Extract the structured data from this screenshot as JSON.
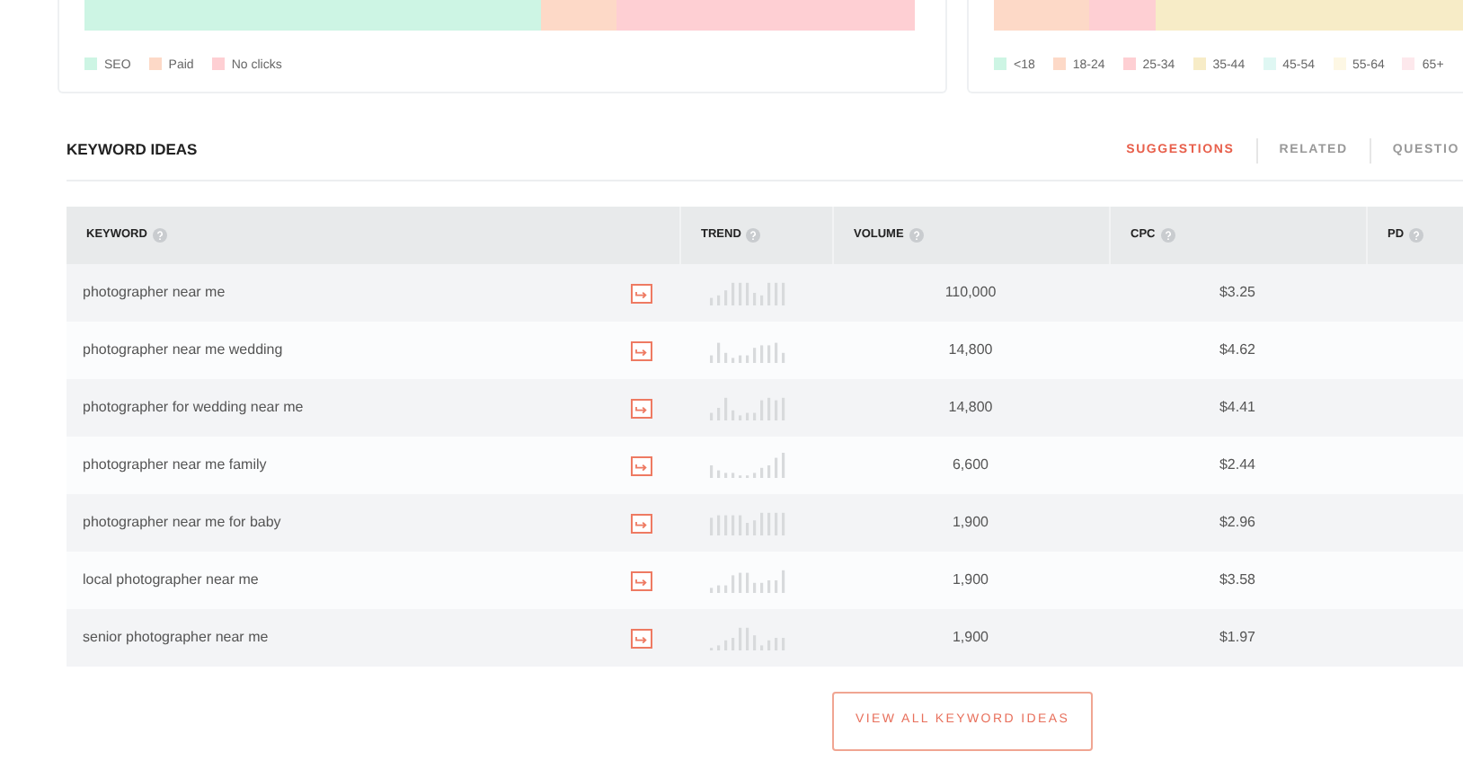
{
  "traffic_card": {
    "legend": [
      {
        "label": "SEO",
        "color": "#cdf5e4"
      },
      {
        "label": "Paid",
        "color": "#fdd9c7"
      },
      {
        "label": "No clicks",
        "color": "#fecfd3"
      }
    ]
  },
  "age_card": {
    "legend": [
      {
        "label": "<18",
        "color": "#cdf5e4"
      },
      {
        "label": "18-24",
        "color": "#fdd9c7"
      },
      {
        "label": "25-34",
        "color": "#fecfd3"
      },
      {
        "label": "35-44",
        "color": "#f7ecc7"
      },
      {
        "label": "45-54",
        "color": "#dff7f3"
      },
      {
        "label": "55-64",
        "color": "#fdf7e4"
      },
      {
        "label": "65+",
        "color": "#fde8ec"
      }
    ]
  },
  "keyword_ideas": {
    "title": "KEYWORD IDEAS",
    "tabs": [
      {
        "label": "SUGGESTIONS",
        "selected": true
      },
      {
        "label": "RELATED",
        "selected": false
      },
      {
        "label": "QUESTIO",
        "selected": false
      }
    ],
    "columns": [
      "KEYWORD",
      "TREND",
      "VOLUME",
      "CPC",
      "PD"
    ],
    "rows": [
      {
        "keyword": "photographer near me",
        "volume": "110,000",
        "cpc": "$3.25"
      },
      {
        "keyword": "photographer near me wedding",
        "volume": "14,800",
        "cpc": "$4.62"
      },
      {
        "keyword": "photographer for wedding near me",
        "volume": "14,800",
        "cpc": "$4.41"
      },
      {
        "keyword": "photographer near me family",
        "volume": "6,600",
        "cpc": "$2.44"
      },
      {
        "keyword": "photographer near me for baby",
        "volume": "1,900",
        "cpc": "$2.96"
      },
      {
        "keyword": "local photographer near me",
        "volume": "1,900",
        "cpc": "$3.58"
      },
      {
        "keyword": "senior photographer near me",
        "volume": "1,900",
        "cpc": "$1.97"
      }
    ],
    "button": "VIEW ALL KEYWORD IDEAS"
  }
}
